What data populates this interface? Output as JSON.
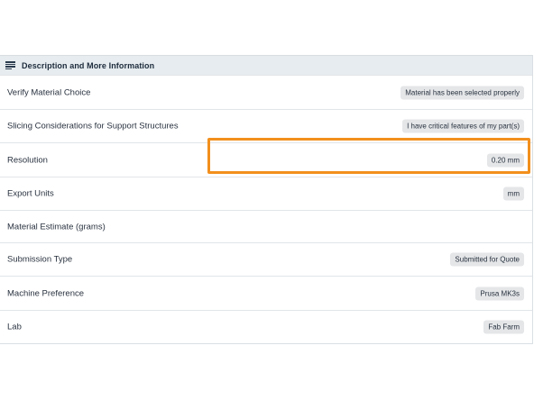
{
  "section": {
    "title": "Description and More Information",
    "icon": "lines-icon"
  },
  "fields": [
    {
      "label": "Verify Material Choice",
      "value": "Material has been selected properly"
    },
    {
      "label": "Slicing Considerations for Support Structures",
      "value": "I have critical features of my part(s)"
    },
    {
      "label": "Resolution",
      "value": "0.20 mm"
    },
    {
      "label": "Export Units",
      "value": "mm"
    },
    {
      "label": "Material Estimate (grams)",
      "value": ""
    },
    {
      "label": "Submission Type",
      "value": "Submitted for Quote"
    },
    {
      "label": "Machine Preference",
      "value": "Prusa MK3s"
    },
    {
      "label": "Lab",
      "value": "Fab Farm"
    }
  ],
  "highlight": {
    "target": "Resolution",
    "color": "#f28f1d"
  }
}
